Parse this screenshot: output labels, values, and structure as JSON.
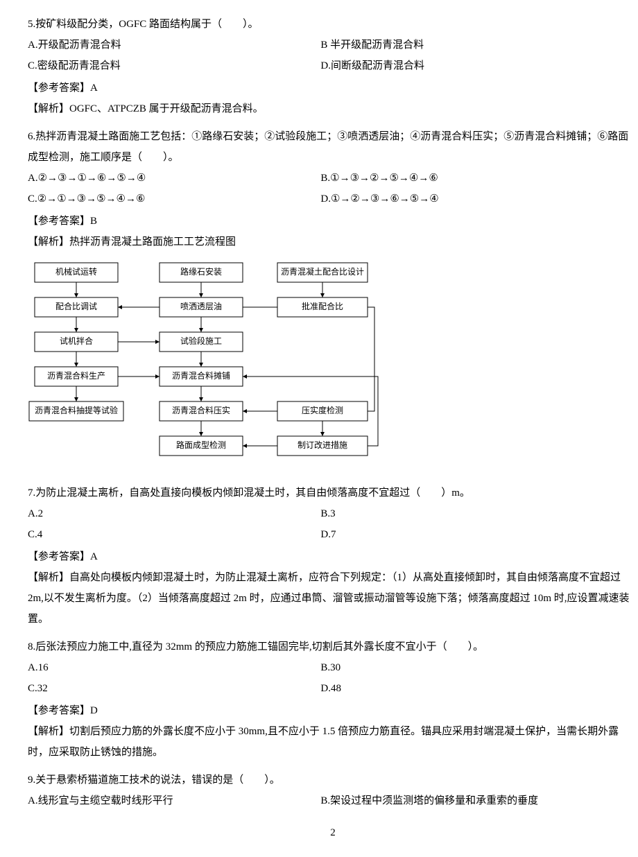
{
  "q5": {
    "text": "5.按矿料级配分类，OGFC 路面结构属于（　　）。",
    "A": "A.开级配沥青混合料",
    "B": "B 半开级配沥青混合料",
    "C": "C.密级配沥青混合料",
    "D": "D.间断级配沥青混合料",
    "ans": "【参考答案】A",
    "expl": "【解析】OGFC、ATPCZB 属于开级配沥青混合料。"
  },
  "q6": {
    "text": "6.热拌沥青混凝土路面施工艺包括：①路缘石安装；②试验段施工；③喷洒透层油；④沥青混合料压实；⑤沥青混合料摊铺；⑥路面成型检测，施工顺序是（　　）。",
    "A": "A.②→③→①→⑥→⑤→④",
    "B": "B.①→③→②→⑤→④→⑥",
    "C": "C.②→①→③→⑤→④→⑥",
    "D": "D.①→②→③→⑥→⑤→④",
    "ans": "【参考答案】B",
    "expl": "【解析】热拌沥青混凝土路面施工工艺流程图"
  },
  "chart": {
    "col1": [
      "机械试运转",
      "配合比调试",
      "试机拌合",
      "沥青混合料生产",
      "沥青混合料抽提等试验"
    ],
    "col2": [
      "路缘石安装",
      "喷洒透层油",
      "试验段施工",
      "沥青混合料摊铺",
      "沥青混合料压实",
      "路面成型检测"
    ],
    "col3": [
      "沥青混凝土配合比设计",
      "批准配合比",
      "压实度检测",
      "制订改进措施"
    ]
  },
  "q7": {
    "text": "7.为防止混凝土离析，自高处直接向模板内倾卸混凝土时，其自由倾落高度不宜超过（　　）m。",
    "A": "A.2",
    "B": "B.3",
    "C": "C.4",
    "D": "D.7",
    "ans": "【参考答案】A",
    "expl": "【解析】自高处向模板内倾卸混凝土时，为防止混凝土离析，应符合下列规定：（1）从高处直接倾卸时，其自由倾落高度不宜超过 2m,以不发生离析为度。（2）当倾落高度超过 2m 时，应通过串筒、溜管或振动溜管等设施下落；倾落高度超过 10m 时,应设置减速装置。"
  },
  "q8": {
    "text": "8.后张法预应力施工中,直径为 32mm 的预应力筋施工锚固完毕,切割后其外露长度不宜小于（　　）。",
    "A": "A.16",
    "B": "B.30",
    "C": "C.32",
    "D": "D.48",
    "ans": "【参考答案】D",
    "expl": "【解析】切割后预应力筋的外露长度不应小于 30mm,且不应小于 1.5 倍预应力筋直径。锚具应采用封端混凝土保护，当需长期外露时，应采取防止锈蚀的措施。"
  },
  "q9": {
    "text": "9.关于悬索桥猫道施工技术的说法，错误的是（　　）。",
    "A": "A.线形宜与主缆空载时线形平行",
    "B": "B.架设过程中须监测塔的偏移量和承重索的垂度"
  },
  "pagenum": "2"
}
